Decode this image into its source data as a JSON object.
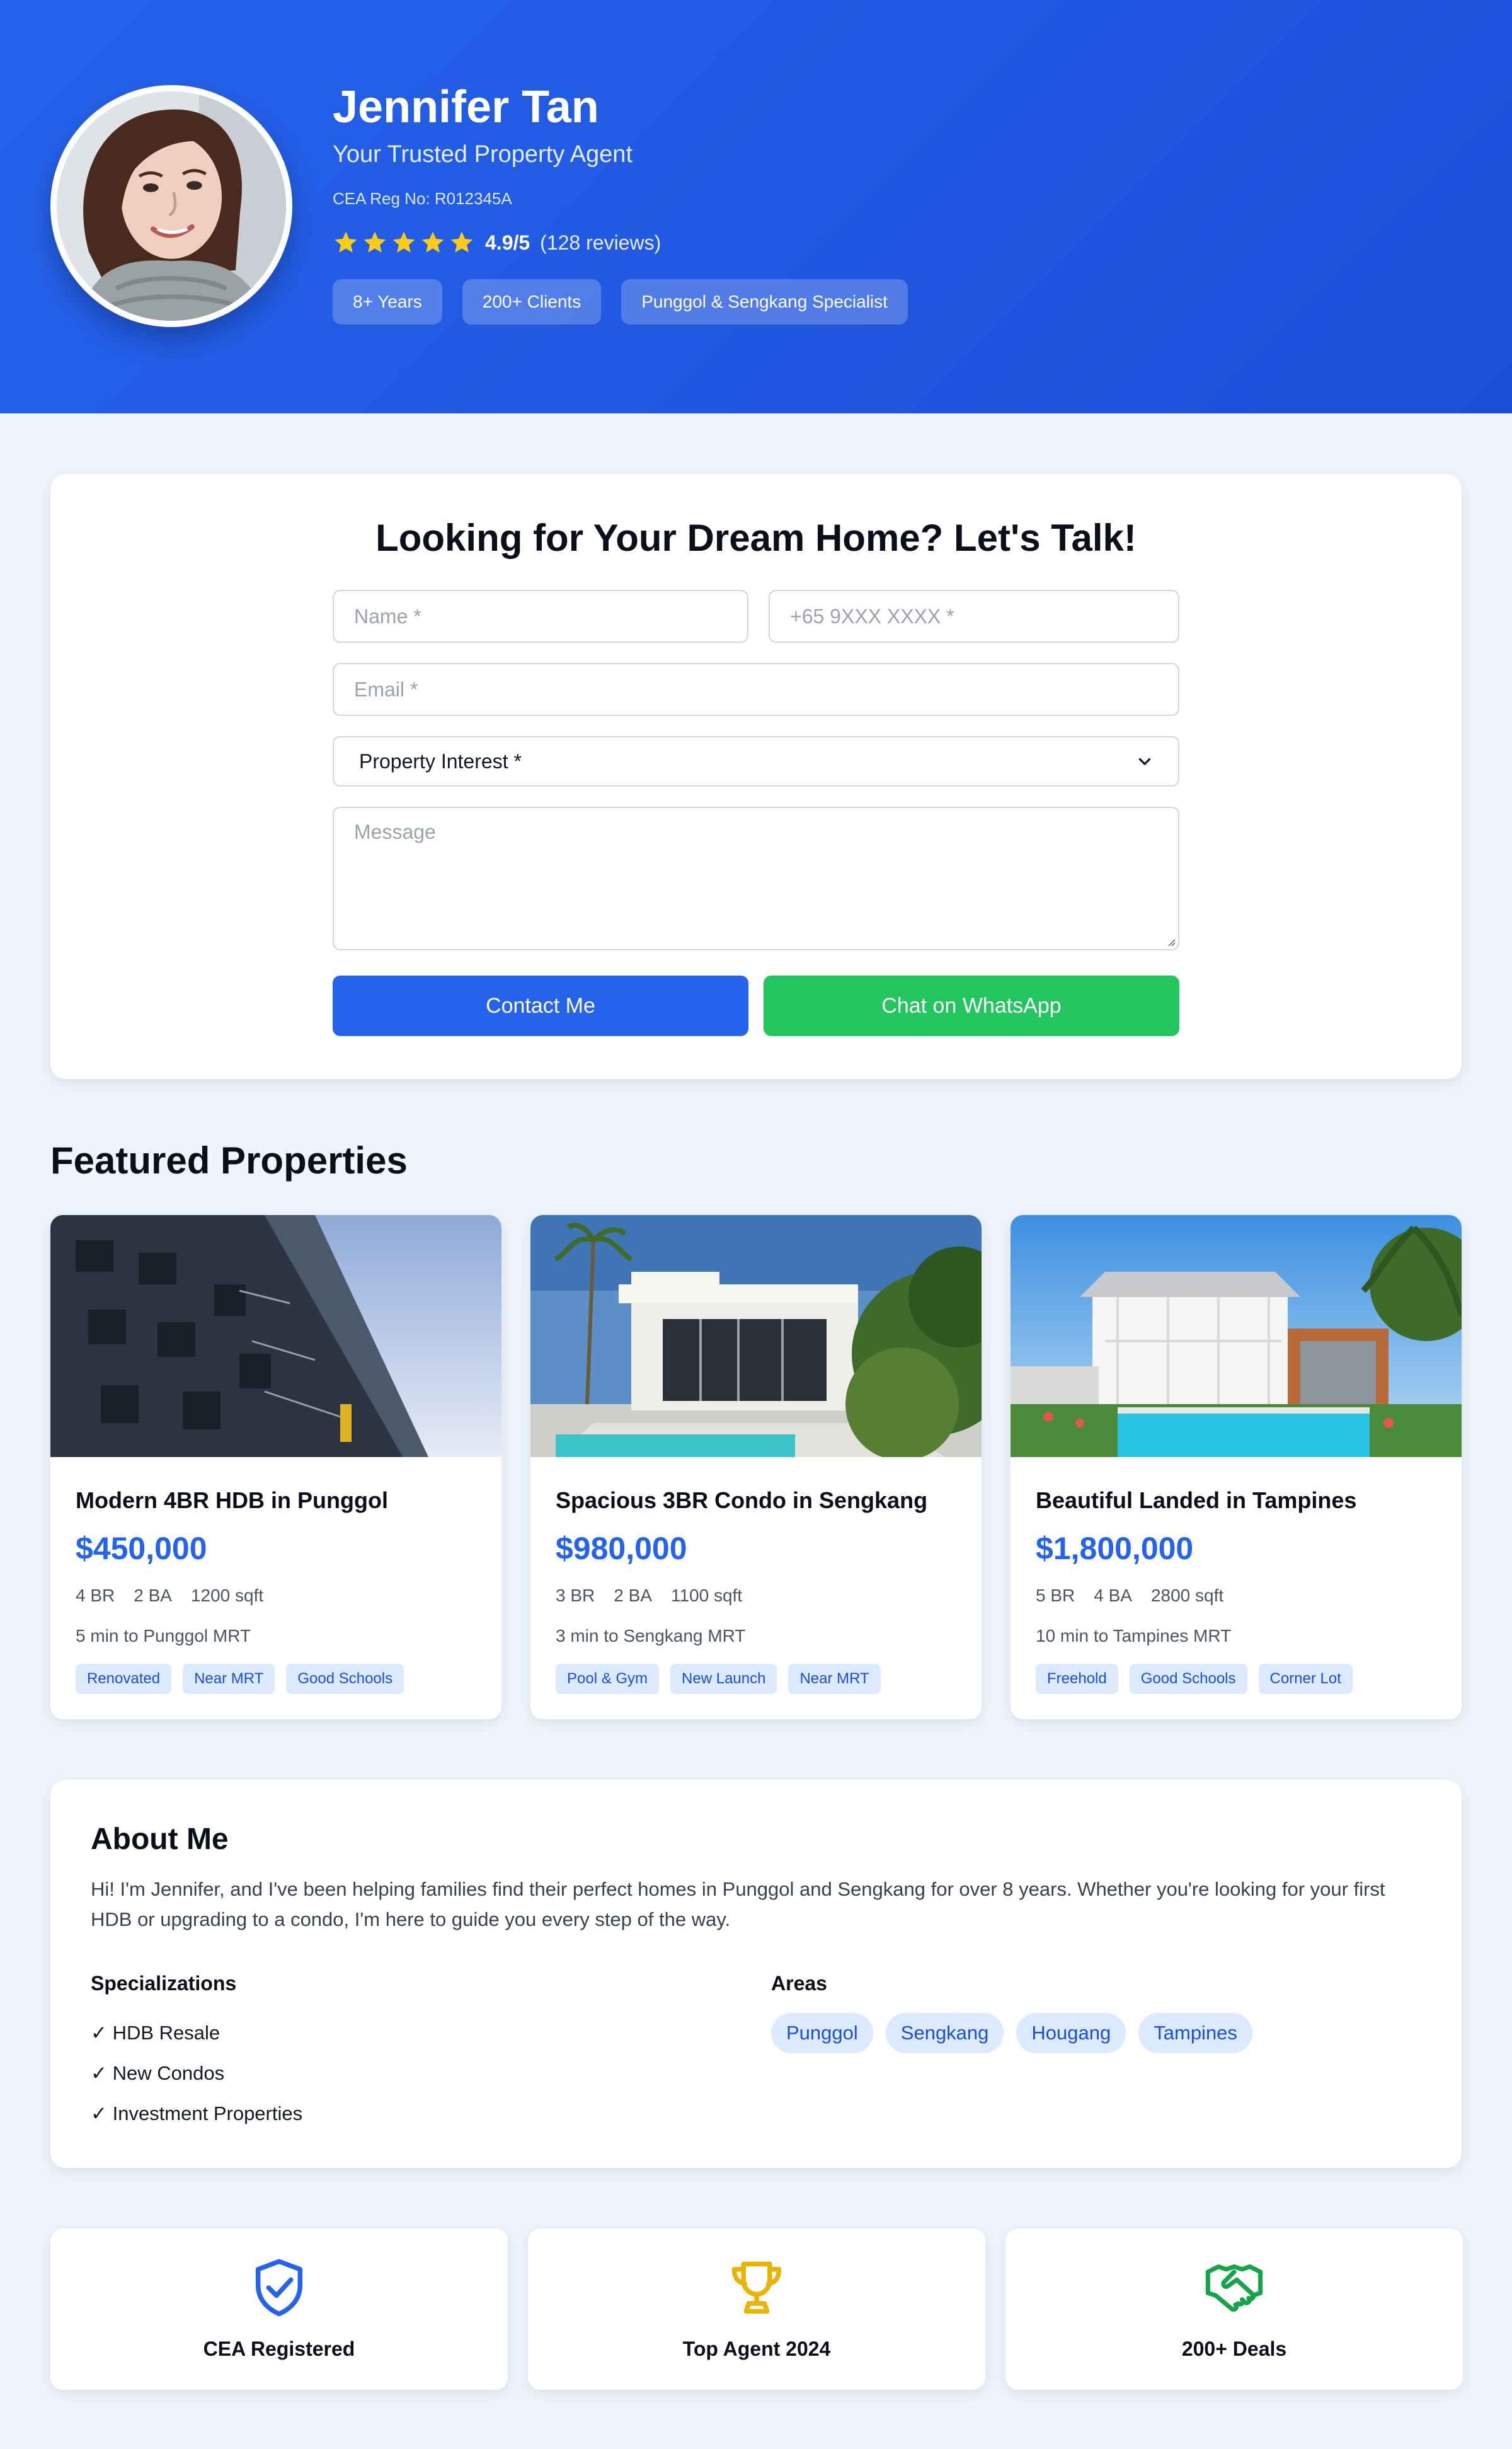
{
  "agent": {
    "name": "Jennifer Tan",
    "tagline": "Your Trusted Property Agent",
    "registration": "CEA Reg No: R012345A",
    "rating_value": "4.9/5",
    "rating_reviews": "(128 reviews)",
    "rating_stars": 5,
    "badges": [
      "8+ Years",
      "200+ Clients",
      "Punggol & Sengkang Specialist"
    ]
  },
  "contact": {
    "title": "Looking for Your Dream Home? Let's Talk!",
    "name_placeholder": "Name *",
    "phone_placeholder": "+65 9XXX XXXX *",
    "email_placeholder": "Email *",
    "interest_selected": "Property Interest *",
    "message_placeholder": "Message",
    "contact_button": "Contact Me",
    "whatsapp_button": "Chat on WhatsApp"
  },
  "featured": {
    "title": "Featured Properties",
    "properties": [
      {
        "title": "Modern 4BR HDB in Punggol",
        "price": "$450,000",
        "beds": "4 BR",
        "baths": "2 BA",
        "size": "1200 sqft",
        "commute": "5 min to Punggol MRT",
        "tags": [
          "Renovated",
          "Near MRT",
          "Good Schools"
        ]
      },
      {
        "title": "Spacious 3BR Condo in Sengkang",
        "price": "$980,000",
        "beds": "3 BR",
        "baths": "2 BA",
        "size": "1100 sqft",
        "commute": "3 min to Sengkang MRT",
        "tags": [
          "Pool & Gym",
          "New Launch",
          "Near MRT"
        ]
      },
      {
        "title": "Beautiful Landed in Tampines",
        "price": "$1,800,000",
        "beds": "5 BR",
        "baths": "4 BA",
        "size": "2800 sqft",
        "commute": "10 min to Tampines MRT",
        "tags": [
          "Freehold",
          "Good Schools",
          "Corner Lot"
        ]
      }
    ]
  },
  "about": {
    "title": "About Me",
    "bio": "Hi! I'm Jennifer, and I've been helping families find their perfect homes in Punggol and Sengkang for over 8 years. Whether you're looking for your first HDB or upgrading to a condo, I'm here to guide you every step of the way.",
    "specializations_title": "Specializations",
    "specializations": [
      "✓ HDB Resale",
      "✓ New Condos",
      "✓ Investment Properties"
    ],
    "areas_title": "Areas",
    "areas": [
      "Punggol",
      "Sengkang",
      "Hougang",
      "Tampines"
    ]
  },
  "credentials": [
    {
      "label": "CEA Registered",
      "icon": "shield-check-icon"
    },
    {
      "label": "Top Agent 2024",
      "icon": "trophy-icon"
    },
    {
      "label": "200+ Deals",
      "icon": "handshake-icon"
    }
  ],
  "colors": {
    "brand_blue": "#2563eb",
    "whatsapp_green": "#22c55e",
    "star_yellow": "#facc15",
    "trophy_gold": "#eab308",
    "deal_green": "#16a34a",
    "page_bg": "#f0f5fd"
  }
}
